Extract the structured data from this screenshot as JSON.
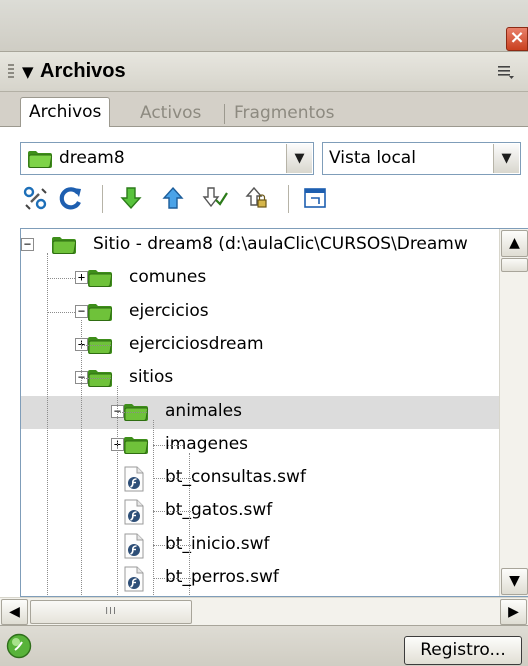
{
  "panel": {
    "title": "Archivos"
  },
  "tabs": [
    {
      "label": "Archivos",
      "active": true
    },
    {
      "label": "Activos",
      "active": false
    },
    {
      "label": "Fragmentos",
      "active": false
    }
  ],
  "site_select": {
    "value": "dream8"
  },
  "view_select": {
    "value": "Vista local"
  },
  "toolbar_icons": [
    "connect-icon",
    "refresh-icon",
    "get-icon",
    "put-icon",
    "check-out-icon",
    "check-in-icon",
    "expand-panel-icon"
  ],
  "tree": [
    {
      "label": "Sitio - dream8 (d:\\aulaClic\\CURSOS\\Dreamw",
      "type": "folder",
      "expander": "minus"
    },
    {
      "label": "comunes",
      "type": "folder",
      "expander": "plus"
    },
    {
      "label": "ejercicios",
      "type": "folder",
      "expander": "minus"
    },
    {
      "label": "ejerciciosdream",
      "type": "folder",
      "expander": "plus"
    },
    {
      "label": "sitios",
      "type": "folder",
      "expander": "minus"
    },
    {
      "label": "animales",
      "type": "folder",
      "expander": "minus",
      "selected": true
    },
    {
      "label": "imagenes",
      "type": "folder",
      "expander": "plus"
    },
    {
      "label": "bt_consultas.swf",
      "type": "swf"
    },
    {
      "label": "bt_gatos.swf",
      "type": "swf"
    },
    {
      "label": "bt_inicio.swf",
      "type": "swf"
    },
    {
      "label": "bt_perros.swf",
      "type": "swf"
    }
  ],
  "scroll_glyphs": {
    "h_thumb": "III"
  },
  "status": {
    "registro_label": "Registro..."
  },
  "close_glyph": "×",
  "colors": {
    "folder": "#6fc23a",
    "selection": "#dcdcdc",
    "close": "#d9532f"
  }
}
